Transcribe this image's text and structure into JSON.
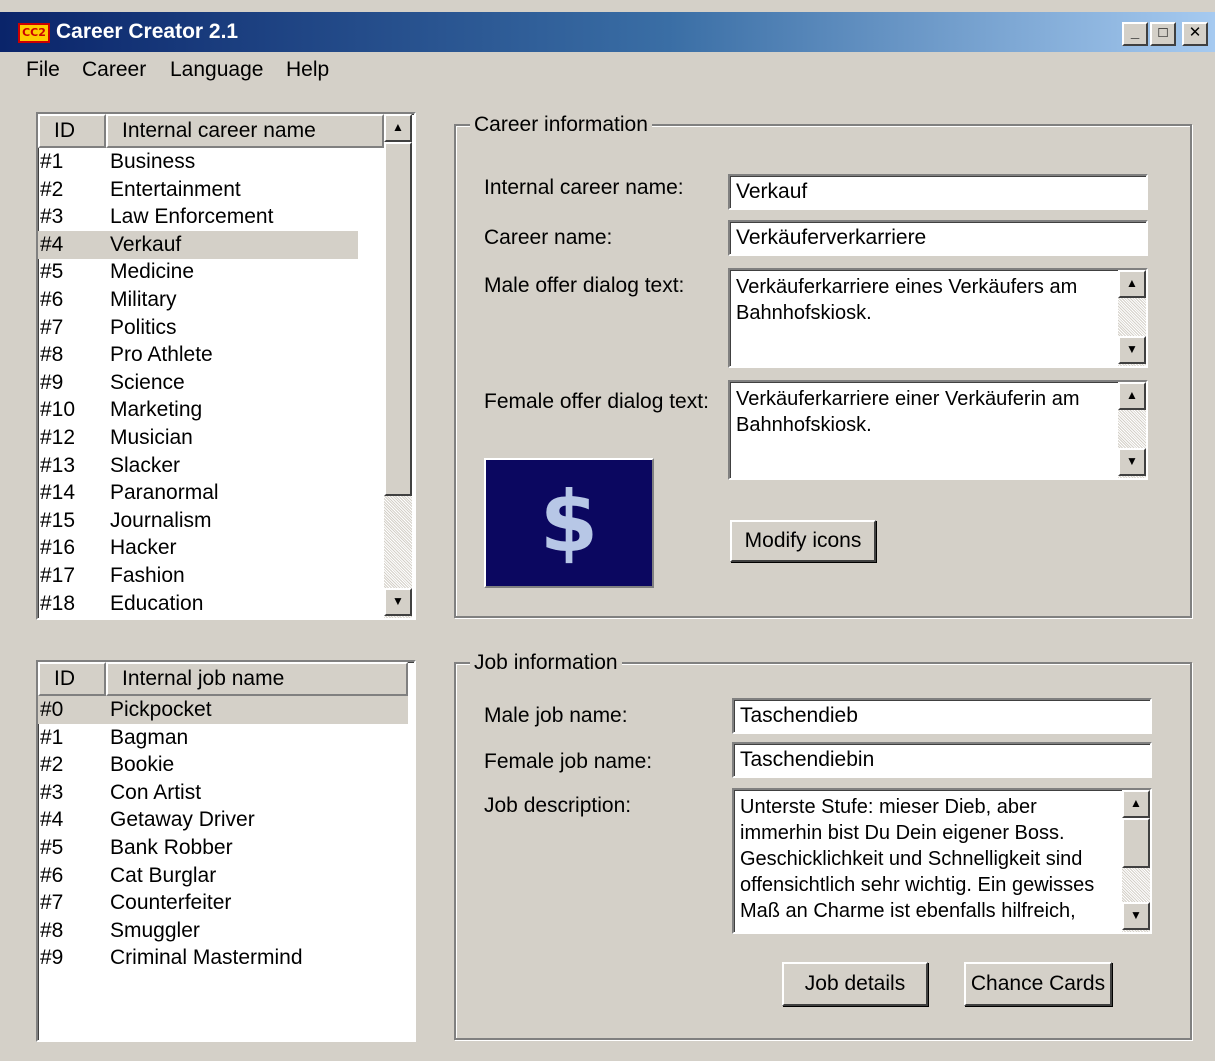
{
  "window": {
    "title": "Career Creator 2.1",
    "app_icon_text": "CC2",
    "minimize": "_",
    "maximize": "□",
    "close": "✕"
  },
  "menu": [
    "File",
    "Career",
    "Language",
    "Help"
  ],
  "careers_list": {
    "headers": [
      "ID",
      "Internal career name"
    ],
    "selected_id": "#4",
    "rows": [
      {
        "id": "#1",
        "name": "Business"
      },
      {
        "id": "#2",
        "name": "Entertainment"
      },
      {
        "id": "#3",
        "name": "Law Enforcement"
      },
      {
        "id": "#4",
        "name": "Verkauf"
      },
      {
        "id": "#5",
        "name": "Medicine"
      },
      {
        "id": "#6",
        "name": "Military"
      },
      {
        "id": "#7",
        "name": "Politics"
      },
      {
        "id": "#8",
        "name": "Pro Athlete"
      },
      {
        "id": "#9",
        "name": "Science"
      },
      {
        "id": "#10",
        "name": "Marketing"
      },
      {
        "id": "#12",
        "name": "Musician"
      },
      {
        "id": "#13",
        "name": "Slacker"
      },
      {
        "id": "#14",
        "name": "Paranormal"
      },
      {
        "id": "#15",
        "name": "Journalism"
      },
      {
        "id": "#16",
        "name": "Hacker"
      },
      {
        "id": "#17",
        "name": "Fashion"
      },
      {
        "id": "#18",
        "name": "Education"
      }
    ]
  },
  "jobs_list": {
    "headers": [
      "ID",
      "Internal job name"
    ],
    "selected_id": "#0",
    "rows": [
      {
        "id": "#0",
        "name": "Pickpocket"
      },
      {
        "id": "#1",
        "name": "Bagman"
      },
      {
        "id": "#2",
        "name": "Bookie"
      },
      {
        "id": "#3",
        "name": "Con Artist"
      },
      {
        "id": "#4",
        "name": "Getaway Driver"
      },
      {
        "id": "#5",
        "name": "Bank Robber"
      },
      {
        "id": "#6",
        "name": "Cat Burglar"
      },
      {
        "id": "#7",
        "name": "Counterfeiter"
      },
      {
        "id": "#8",
        "name": "Smuggler"
      },
      {
        "id": "#9",
        "name": "Criminal Mastermind"
      }
    ]
  },
  "career_info": {
    "legend": "Career information",
    "internal_name_label": "Internal career name:",
    "internal_name_value": "Verkauf",
    "career_name_label": "Career name:",
    "career_name_value": "Verkäuferverkarriere",
    "male_offer_label": "Male offer dialog text:",
    "male_offer_value": "Verkäuferkarriere eines Verkäufers am Bahnhofskiosk.",
    "female_offer_label": "Female offer dialog text:",
    "female_offer_value": "Verkäuferkarriere einer Verkäuferin am Bahnhofskiosk.",
    "icon_symbol": "$",
    "modify_icons_label": "Modify icons"
  },
  "job_info": {
    "legend": "Job information",
    "male_job_label": "Male job name:",
    "male_job_value": "Taschendieb",
    "female_job_label": "Female job name:",
    "female_job_value": "Taschendiebin",
    "description_label": "Job description:",
    "description_value": "Unterste Stufe: mieser Dieb, aber immerhin bist Du Dein eigener Boss. Geschicklichkeit und Schnelligkeit sind offensichtlich sehr wichtig. Ein gewisses Maß an Charme ist ebenfalls hilfreich,",
    "job_details_label": "Job details",
    "chance_cards_label": "Chance Cards"
  },
  "scroll_glyphs": {
    "up": "▲",
    "down": "▼"
  }
}
